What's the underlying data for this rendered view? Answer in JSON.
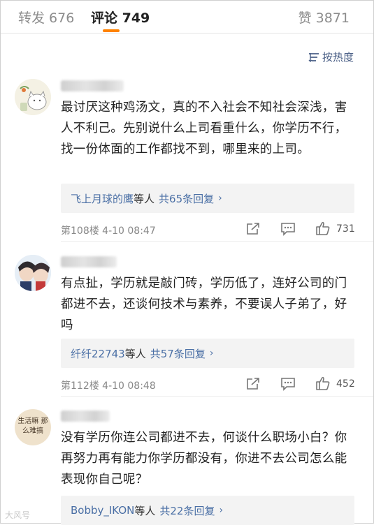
{
  "tabs": {
    "repost": "转发 676",
    "comments": "评论 749",
    "likes": "赞 3871"
  },
  "sort_label": "按热度",
  "comments": [
    {
      "text": "最讨厌这种鸡汤文，真的不入社会不知社会深浅，害人不利己。先别说什么上司看重什么，你学历不行，找一份体面的工作都找不到，哪里来的上司。",
      "replies": {
        "who": "飞上月球的鹰",
        "mid": "等人",
        "count": "共65条回复"
      },
      "floor_time": "第108楼  4-10 08:47",
      "likes": "731"
    },
    {
      "text": "有点扯，学历就是敲门砖，学历低了，连好公司的门都进不去，还谈何技术与素养，不要误人子弟了，好吗",
      "replies": {
        "who": "纤纤22743",
        "mid": "等人",
        "count": "共57条回复"
      },
      "floor_time": "第112楼  4-10 08:48",
      "likes": "452"
    },
    {
      "text": "没有学历你连公司都进不去，何谈什么职场小白？你再努力再有能力你学历都没有，你进不去公司怎么能表现你自己呢？",
      "replies": {
        "who": "Bobby_IKON",
        "mid": "等人",
        "count": "共22条回复"
      }
    }
  ],
  "avatar3_text": "生活嘛 那么难搞",
  "watermark": "大风号"
}
